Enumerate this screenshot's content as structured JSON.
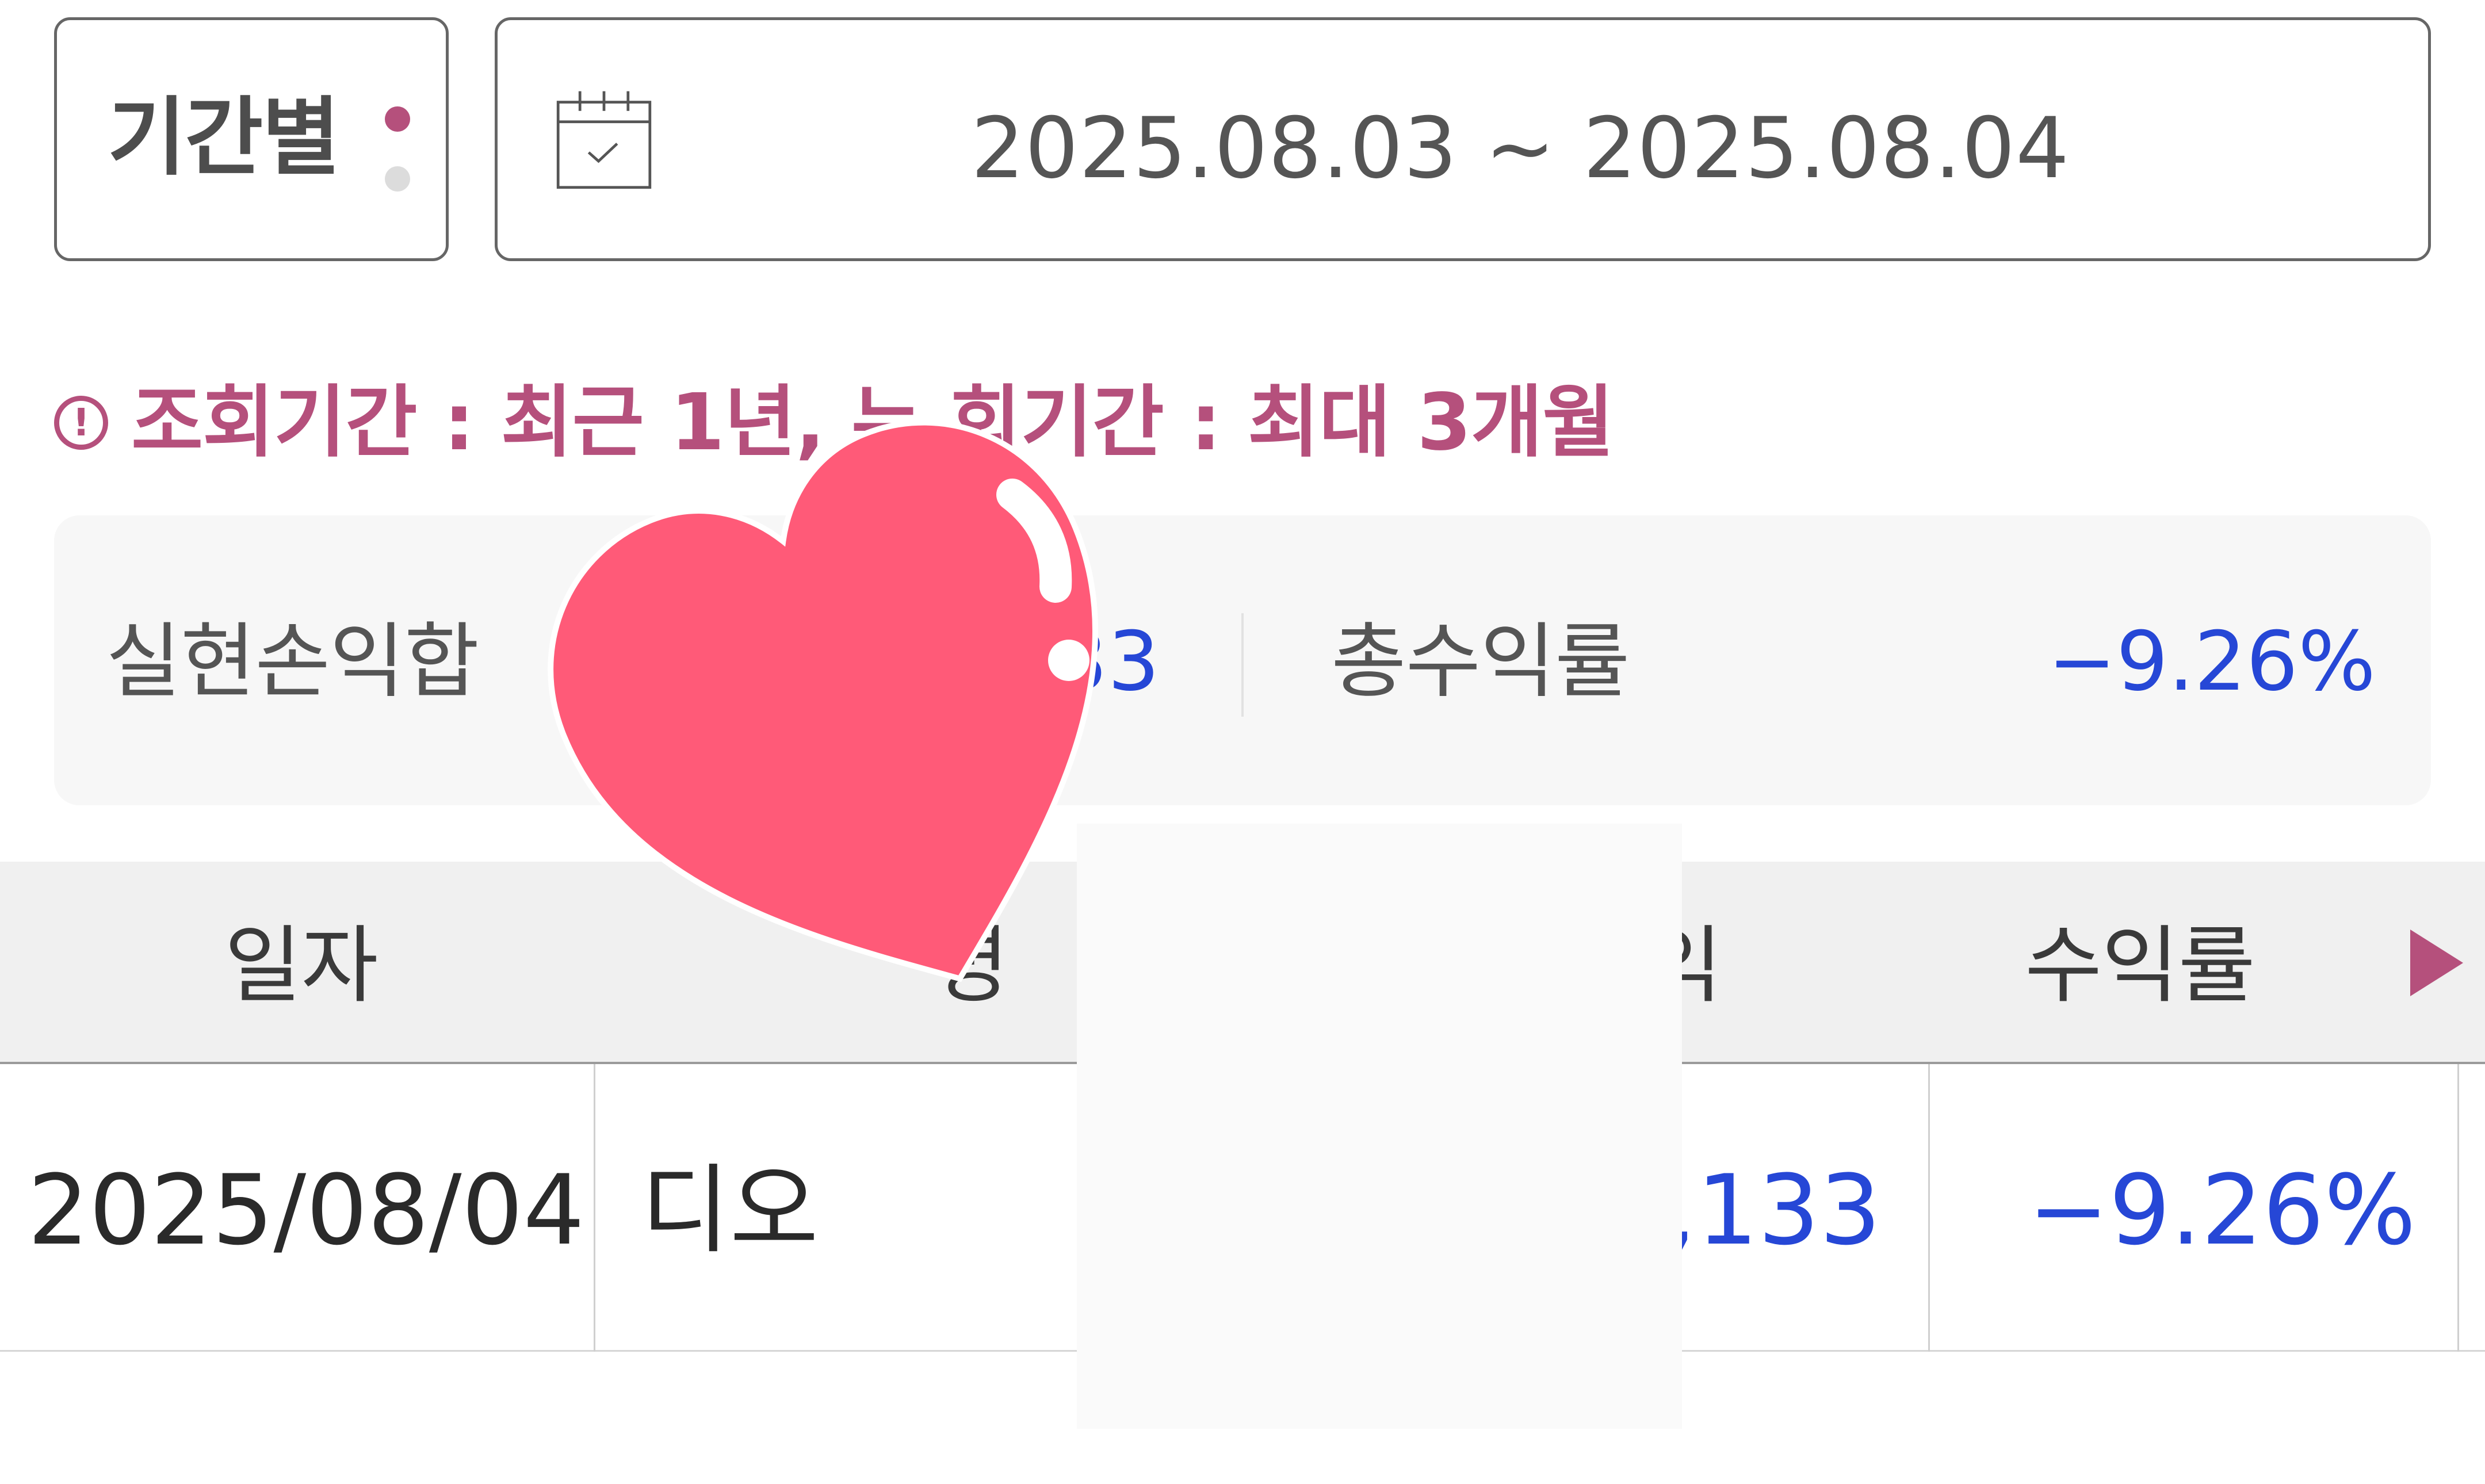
{
  "filter": {
    "period_label": "기간별",
    "date_range": "2025.08.03 ~ 2025.08.04",
    "active_dot_color": "#b5507c",
    "inactive_dot_color": "#dcdcdc"
  },
  "notice": {
    "text": "조회기간 : 최근 1년, 누    회기간 : 최대 3개월"
  },
  "summary": {
    "realized_label": "실현손익합",
    "realized_value_partial": "33",
    "total_return_label": "총수익률",
    "total_return_value": "−9.26%"
  },
  "table": {
    "headers": {
      "date": "일자",
      "name_partial": "명",
      "profit_partial": "익",
      "return": "수익률"
    },
    "rows": [
      {
        "date": "2025/08/04",
        "name": "디오",
        "profit_partial": ",133",
        "return": "−9.26%"
      }
    ]
  },
  "colors": {
    "accent": "#b5507c",
    "negative": "#2647d6",
    "heart": "#ff5a78"
  }
}
